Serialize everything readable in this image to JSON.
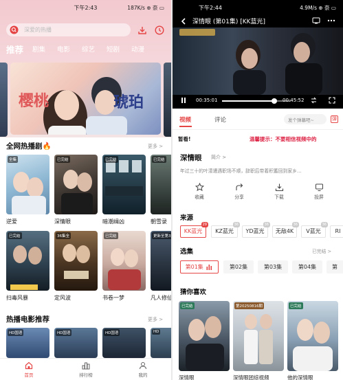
{
  "left": {
    "status": {
      "time": "下午2:43",
      "net": "187K/s ⊕ 奈 ▭"
    },
    "search_placeholder": "深爱的热播",
    "categories": [
      "推荐",
      "剧集",
      "电影",
      "综艺",
      "短剧",
      "动漫"
    ],
    "banner": {
      "title_a": "樱桃",
      "title_b": "琥珀"
    },
    "sections": [
      {
        "title": "全网热播剧🔥",
        "more": "更多 >"
      },
      {
        "title": "热播电影推荐",
        "more": "更多 >"
      }
    ],
    "hot_dramas": [
      {
        "tag": "全集",
        "title": "逆爱"
      },
      {
        "tag": "已完结",
        "title": "深情眼"
      },
      {
        "tag": "已完结",
        "title": "暗潮缉凶"
      },
      {
        "tag": "已完结",
        "title": "朝雪录"
      },
      {
        "tag": "已完结",
        "title": "扫毒风暴"
      },
      {
        "tag": "36集全",
        "title": "定风波"
      },
      {
        "tag": "已完结",
        "title": "书卷一梦"
      },
      {
        "tag": "更新至第3集",
        "title": "凡人修仙传"
      }
    ],
    "movie_tags": [
      "HD国语",
      "HD国语",
      "HD国语",
      "HD"
    ],
    "nav": [
      "首页",
      "排行榜",
      "我的"
    ]
  },
  "right": {
    "status": {
      "time": "下午2:44",
      "net": "4.9M/s ⊕ 奈 ▭"
    },
    "title": "深情眼 (第01集) [KK蓝光]",
    "time_current": "00:35:01",
    "time_total": "00:45:52",
    "progress": 0.76,
    "tabs": [
      "视频",
      "评论"
    ],
    "danmu_placeholder": "发个弹幕吧~",
    "notice_a": "暂看!",
    "notice_b": "温馨提示：不要相信视频中的",
    "show_title": "深情眼",
    "intro": "简介 >",
    "desc": "年过三十的叶濛遭遇职场不顺，辞职后带着积蓄回到家乡…",
    "actions": [
      "收藏",
      "分享",
      "下载",
      "投屏"
    ],
    "source_label": "来源",
    "sources": [
      {
        "name": "KK蓝光",
        "badge": "29"
      },
      {
        "name": "KZ蓝光",
        "badge": "36"
      },
      {
        "name": "YD蓝光",
        "badge": "36"
      },
      {
        "name": "无敌4K",
        "badge": "36"
      },
      {
        "name": "V蓝光",
        "badge": "36"
      },
      {
        "name": "RI",
        "badge": ""
      }
    ],
    "episodes_label": "选集",
    "episodes_status": "已完结 >",
    "episodes": [
      "第01集",
      "第02集",
      "第03集",
      "第04集",
      "第"
    ],
    "guess_label": "猜你喜欢",
    "guesses": [
      {
        "tag": "已完结",
        "title": "深情眼"
      },
      {
        "tag": "第20250816期",
        "title": "深情眼团综视频"
      },
      {
        "tag": "已完结",
        "title": "他的深情眼"
      }
    ]
  }
}
